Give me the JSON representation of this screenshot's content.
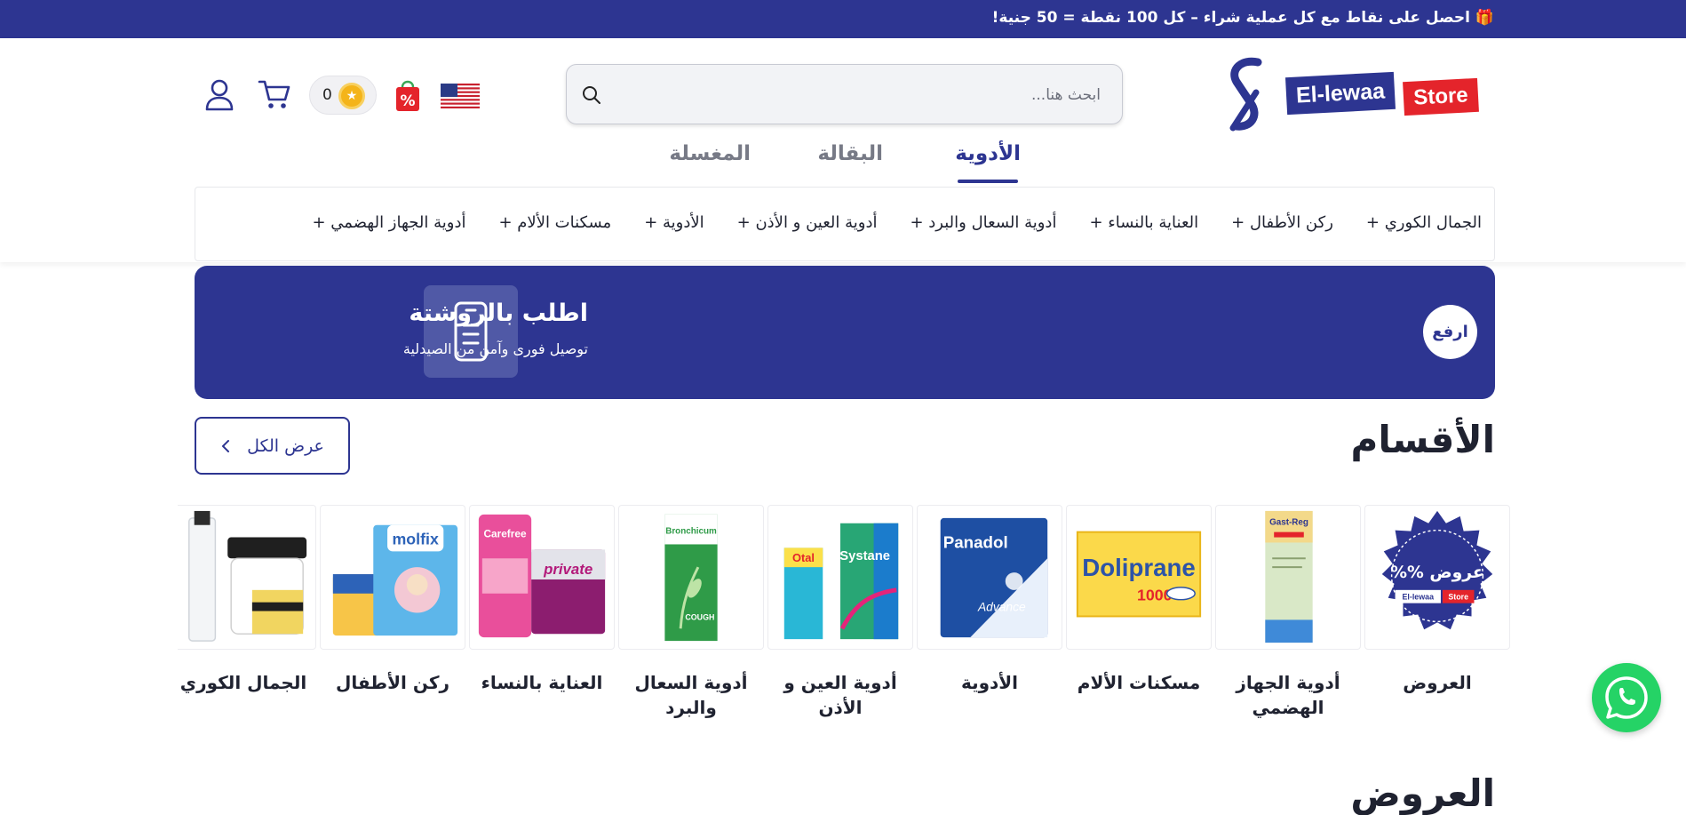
{
  "promo_bar": {
    "text": "🎁 احصل على نقاط مع كل عملية شراء – كل 100 نقطة = 50 جنية!"
  },
  "logo": {
    "name": "El-lewaa",
    "store": "Store"
  },
  "search": {
    "placeholder": "ابحث هنا..."
  },
  "header": {
    "points": "0"
  },
  "tabs": [
    {
      "label": "الأدوية",
      "active": true
    },
    {
      "label": "البقالة",
      "active": false
    },
    {
      "label": "المغسلة",
      "active": false
    }
  ],
  "category_nav": [
    "الجمال الكوري +",
    "ركن الأطفال +",
    "العناية بالنساء +",
    "أدوية السعال والبرد +",
    "أدوية العين و الأذن +",
    "الأدوية +",
    "مسكنات الألام +",
    "أدوية الجهاز الهضمي +"
  ],
  "banner": {
    "title": "اطلب بالروشتة",
    "subtitle": "توصيل فورى وآمن من الصيدلية",
    "upload_label": "ارفع"
  },
  "categories_section": {
    "title": "الأقسام",
    "view_all": "عرض الكل",
    "items": [
      {
        "label": "العروض",
        "badge": "عروض %%"
      },
      {
        "label": "أدوية الجهاز الهضمي",
        "product": "Gast-Reg"
      },
      {
        "label": "مسكنات الألام",
        "product": "Doliprane"
      },
      {
        "label": "الأدوية",
        "product": "Panadol"
      },
      {
        "label": "أدوية العين و الأذن",
        "product": "Systane"
      },
      {
        "label": "أدوية السعال والبرد",
        "product": "Bronchicum"
      },
      {
        "label": "العناية بالنساء",
        "product": "Carefree"
      },
      {
        "label": "ركن الأطفال",
        "product": "molfix"
      },
      {
        "label": "الجمال الكوري",
        "product": ""
      }
    ]
  },
  "offers_section": {
    "title": "العروض"
  },
  "colors": {
    "brand": "#2d3591",
    "accent": "#e4242b",
    "whatsapp": "#25d366"
  },
  "icons": [
    "search-icon",
    "us-flag-icon",
    "offers-bag-icon",
    "coin-icon",
    "cart-icon",
    "user-icon",
    "phone-icon",
    "chevron-left-icon",
    "whatsapp-icon"
  ]
}
